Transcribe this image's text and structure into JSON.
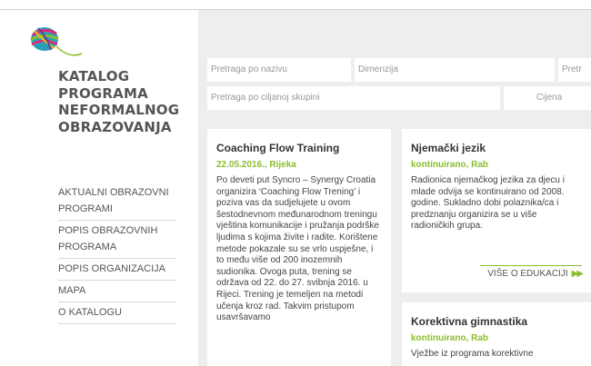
{
  "brand": {
    "title_lines": [
      "KATALOG",
      "PROGRAMA",
      "NEFORMALNOG",
      "OBRAZOVANJA"
    ]
  },
  "nav": {
    "items": [
      {
        "label": "AKTUALNI OBRAZOVNI PROGRAMI"
      },
      {
        "label": "POPIS OBRAZOVNIH PROGRAMA"
      },
      {
        "label": "POPIS ORGANIZACIJA"
      },
      {
        "label": "MAPA"
      },
      {
        "label": "O KATALOGU"
      }
    ]
  },
  "search": {
    "name_placeholder": "Pretraga po nazivu",
    "dimension_placeholder": "Dimenzija",
    "third_placeholder": "Pretr",
    "target_group_placeholder": "Pretraga po ciljanoj skupini",
    "price_placeholder": "Cijena"
  },
  "cards": [
    {
      "title": "Coaching Flow Training",
      "meta": "22.05.2016., Rijeka",
      "body": "Po deveti put Syncro – Synergy Croatia organizira ‘Coaching Flow Trening’ i poziva vas da sudjelujete u ovom šestodnevnom međunarodnom treningu vještina komunikacije i pružanja podrške ljudima s kojima živite i radite. Korištene metode pokazale su se vrlo uspješne, i to među više od 200 inozemnih sudionika. Ovoga puta, trening se održava od 22. do 27. svibnja 2016. u Rijeci. Trening je temeljen na metodi učenja kroz rad. Takvim pristupom usavršavamo"
    },
    {
      "title": "Njemački jezik",
      "meta": "kontinuirano, Rab",
      "body": "Radionica njemačkog jezika za djecu i mlade odvija se kontinuirano od 2008. godine. Sukladno dobi polaznika/ca i predznanju organizira se u više radioničkih grupa.",
      "more": "VIŠE O EDUKACIJI"
    },
    {
      "title": "Korektivna gimnastika",
      "meta": "kontinuirano, Rab",
      "body": "Vježbe iz programa korektivne"
    }
  ],
  "colors": {
    "accent": "#8cbd2f",
    "background": "#eeeeee"
  }
}
